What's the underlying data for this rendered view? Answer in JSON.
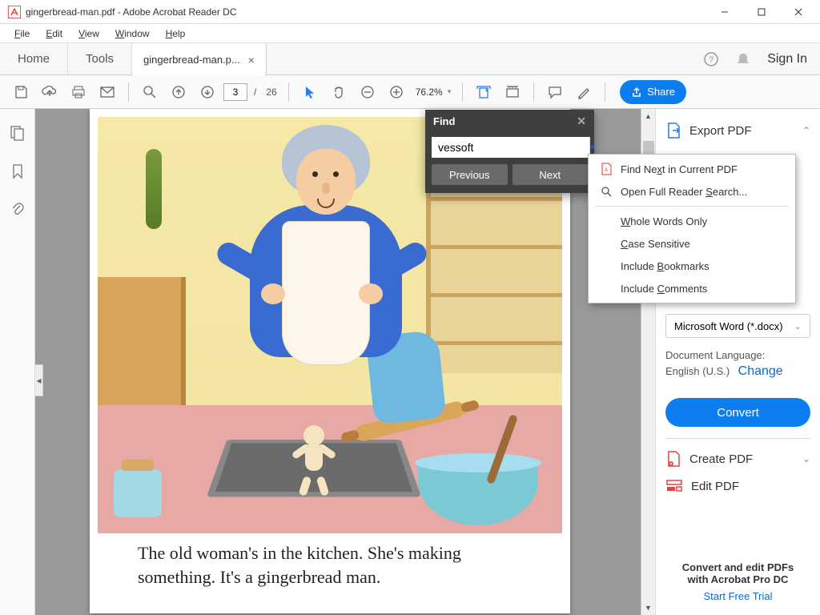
{
  "title": "gingerbread-man.pdf - Adobe Acrobat Reader DC",
  "menu": {
    "file": "File",
    "edit": "Edit",
    "view": "View",
    "window": "Window",
    "help": "Help"
  },
  "tabs": {
    "home": "Home",
    "tools": "Tools",
    "doc": "gingerbread-man.p..."
  },
  "signin": "Sign In",
  "toolbar": {
    "page_current": "3",
    "page_total": "26",
    "zoom": "76.2%",
    "share": "Share"
  },
  "page_text": "The old woman's in the kitchen. She's making something. It's a gingerbread man.",
  "find": {
    "title": "Find",
    "value": "vessoft",
    "previous": "Previous",
    "next": "Next"
  },
  "ctx": {
    "find_next": "Find Next in Current PDF",
    "full_search": "Open Full Reader Search...",
    "whole_words": "Whole Words Only",
    "case_sensitive": "Case Sensitive",
    "bookmarks": "Include Bookmarks",
    "comments": "Include Comments"
  },
  "right": {
    "export": "Export PDF",
    "format_select": "Microsoft Word (*.docx)",
    "doc_lang_label": "Document Language:",
    "doc_lang_value": "English (U.S.)",
    "change": "Change",
    "convert": "Convert",
    "create": "Create PDF",
    "edit": "Edit PDF",
    "footer1": "Convert and edit PDFs",
    "footer2": "with Acrobat Pro DC",
    "trial": "Start Free Trial"
  }
}
